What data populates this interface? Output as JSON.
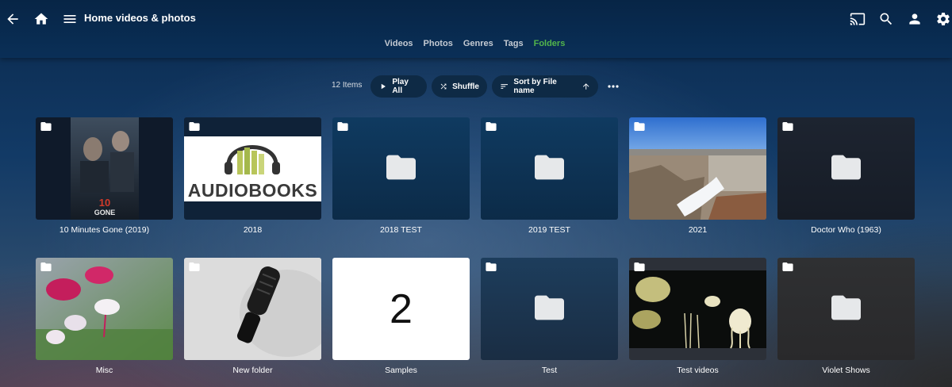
{
  "header": {
    "title": "Home videos & photos",
    "icons": [
      "back-icon",
      "home-icon",
      "menu-icon",
      "cast-icon",
      "search-icon",
      "user-icon",
      "settings-icon"
    ]
  },
  "tabs": [
    {
      "label": "Videos",
      "active": false
    },
    {
      "label": "Photos",
      "active": false
    },
    {
      "label": "Genres",
      "active": false
    },
    {
      "label": "Tags",
      "active": false
    },
    {
      "label": "Folders",
      "active": true
    }
  ],
  "toolbar": {
    "count": "12 Items",
    "play_all": "Play All",
    "shuffle": "Shuffle",
    "sort": "Sort by File name"
  },
  "items": [
    {
      "label": "10 Minutes Gone (2019)",
      "kind": "poster"
    },
    {
      "label": "2018",
      "kind": "audiobooks",
      "image_text": "AUDIOBOOKS"
    },
    {
      "label": "2018 TEST",
      "kind": "folder"
    },
    {
      "label": "2019 TEST",
      "kind": "folder"
    },
    {
      "label": "2021",
      "kind": "photo-dam"
    },
    {
      "label": "Doctor Who (1963)",
      "kind": "folder"
    },
    {
      "label": "Misc",
      "kind": "photo-flower"
    },
    {
      "label": "New folder",
      "kind": "photo-mic"
    },
    {
      "label": "Samples",
      "kind": "number",
      "image_text": "2"
    },
    {
      "label": "Test",
      "kind": "folder"
    },
    {
      "label": "Test videos",
      "kind": "photo-jelly"
    },
    {
      "label": "Violet Shows",
      "kind": "folder"
    }
  ],
  "colors": {
    "accent": "#52b54b",
    "header_bg": "#0a2f57",
    "pill_bg": "#0e2a45"
  }
}
